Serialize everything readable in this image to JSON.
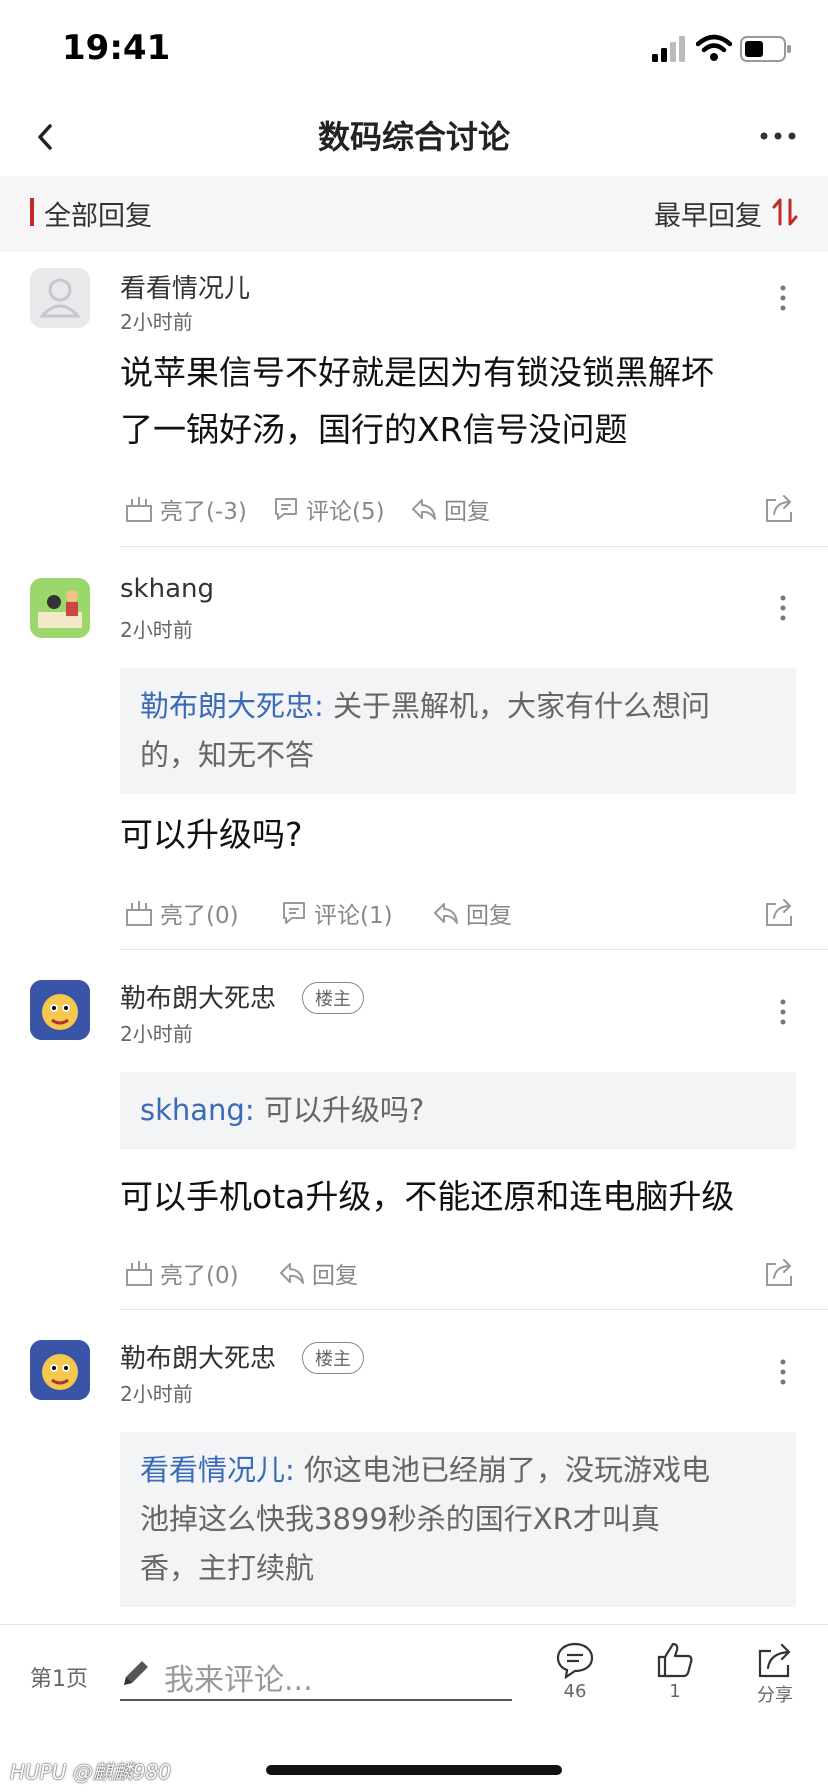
{
  "status": {
    "time": "19:41"
  },
  "nav": {
    "title": "数码综合讨论"
  },
  "filter": {
    "all_replies": "全部回复",
    "sort_label": "最早回复"
  },
  "posts": [
    {
      "username": "看看情况儿",
      "time": "2小时前",
      "body_lines": [
        "说苹果信号不好就是因为有锁没锁黑解坏",
        "了一锅好汤，国行的XR信号没问题"
      ],
      "actions": {
        "light": "亮了(-3)",
        "comment": "评论(5)",
        "reply": "回复"
      }
    },
    {
      "username": "skhang",
      "time": "2小时前",
      "quote": {
        "name": "勒布朗大死忠:",
        "text_lines": [
          "关于黑解机，大家有什么想问",
          "的，知无不答"
        ]
      },
      "body_lines": [
        "可以升级吗?"
      ],
      "actions": {
        "light": "亮了(0)",
        "comment": "评论(1)",
        "reply": "回复"
      }
    },
    {
      "username": "勒布朗大死忠",
      "badge": "楼主",
      "time": "2小时前",
      "quote": {
        "name": "skhang:",
        "text_lines": [
          "可以升级吗?"
        ]
      },
      "body_lines": [
        "可以手机ota升级，不能还原和连电脑升级"
      ],
      "actions": {
        "light": "亮了(0)",
        "reply": "回复"
      }
    },
    {
      "username": "勒布朗大死忠",
      "badge": "楼主",
      "time": "2小时前",
      "quote": {
        "name": "看看情况儿:",
        "text_lines": [
          "你这电池已经崩了，没玩游戏电",
          "池掉这么快我3899秒杀的国行XR才叫真",
          "香，主打续航"
        ]
      }
    }
  ],
  "bottom": {
    "page": "第1页",
    "placeholder": "我来评论...",
    "comments_count": "46",
    "likes_count": "1",
    "share_label": "分享"
  },
  "watermark": {
    "brand": "HUPU",
    "handle": "@麒麟980"
  },
  "colors": {
    "accent_red": "#c42a2a",
    "quote_name_blue": "#3a6ab8"
  }
}
